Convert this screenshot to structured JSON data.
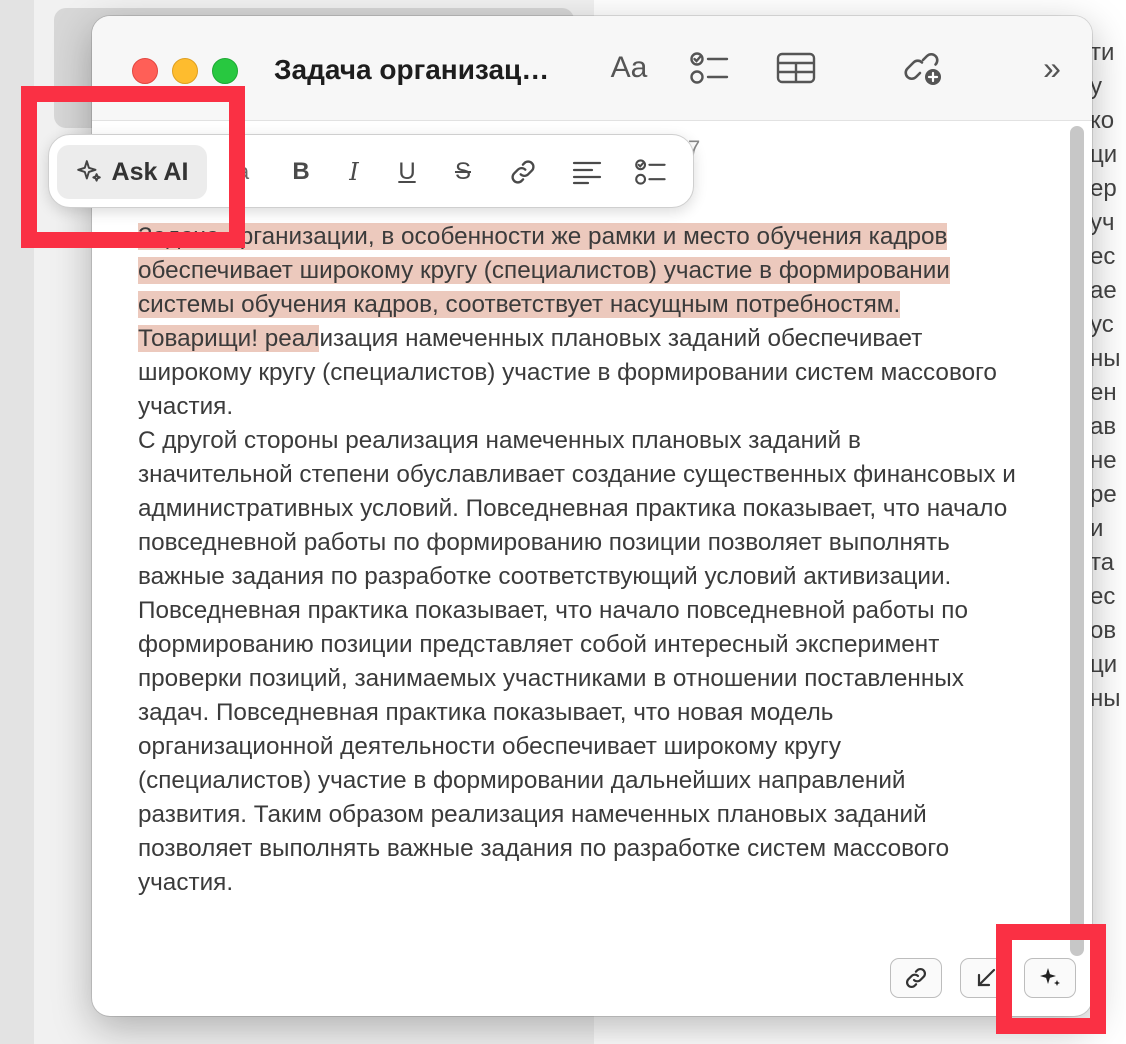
{
  "background": {
    "right_text_fragments": [
      "ти",
      "у",
      "ко",
      "ци",
      "ер",
      "уч",
      "ес",
      "ае",
      "ус",
      "ны",
      "ен",
      "ав",
      "не",
      "ре",
      "и",
      "та",
      "ес",
      "ов",
      "ци",
      "ны"
    ]
  },
  "window": {
    "title": "Задача организац…",
    "toolbar": {
      "font_label": "Aa",
      "more_label": "»"
    },
    "date_fragment": "7",
    "content": {
      "paragraph1": {
        "highlighted": "Задача организации, в особенности же рамки и место обучения кадров обеспечивает широкому кругу (специалистов) участие в формировании системы обучения кадров, соответствует насущным потребностям. Товарищи! реал",
        "rest": "изация намеченных плановых заданий обеспечивает широкому кругу (специалистов) участие в формировании систем массового участия."
      },
      "paragraph2": "С другой стороны реализация намеченных плановых заданий в значительной степени обуславливает создание существенных финансовых и административных условий. Повседневная практика показывает, что начало повседневной работы по формированию позиции позволяет выполнять важные задания по разработке соответствующий условий активизации. Повседневная практика показывает, что начало повседневной работы по формированию позиции представляет собой интересный эксперимент проверки позиций, занимаемых участниками в отношении поставленных задач. Повседневная практика показывает, что новая модель организационной деятельности обеспечивает широкому кругу (специалистов) участие в формировании дальнейших направлений развития. Таким образом реализация намеченных плановых заданий позволяет выполнять важные задания по разработке систем массового участия."
    }
  },
  "format_toolbar": {
    "ask_ai_label": "Ask AI",
    "font_size_label": "a",
    "bold_label": "B",
    "italic_label": "I",
    "underline_label": "U",
    "strike_label": "S"
  },
  "colors": {
    "highlight": "#ecc9bd",
    "annotation_red": "#fa3044"
  }
}
